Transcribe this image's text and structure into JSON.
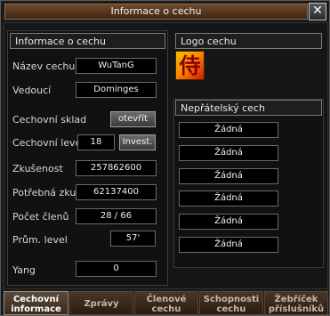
{
  "window": {
    "title": "Informace o cechu",
    "close_glyph": "✕"
  },
  "guild_info": {
    "header": "Informace o cechu",
    "name_label": "Název cechu",
    "name_value": "WuTanG",
    "leader_label": "Vedoucí",
    "leader_value": "Dominges",
    "storage_label": "Cechovní sklad",
    "storage_button": "otevřít",
    "level_label": "Cechovní level",
    "level_value": "18",
    "invest_button": "Invest.",
    "exp_label": "Zkušenost",
    "exp_value": "257862600",
    "needed_exp_label": "Potřebná zkuš.",
    "needed_exp_value": "62137400",
    "members_label": "Počet členů",
    "members_value": "28 / 66",
    "avg_level_label": "Prům. level",
    "avg_level_value": "57'",
    "yang_label": "Yang",
    "yang_value": "0"
  },
  "logo": {
    "header": "Logo cechu",
    "glyph": "侍"
  },
  "enemies": {
    "header": "Nepřátelský cech",
    "slots": [
      "Žádná",
      "Žádná",
      "Žádná",
      "Žádná",
      "Žádná",
      "Žádná"
    ]
  },
  "tabs": [
    {
      "line1": "Cechovní",
      "line2": "informace"
    },
    {
      "line1": "Zprávy",
      "line2": ""
    },
    {
      "line1": "Členové",
      "line2": "cechu"
    },
    {
      "line1": "Schopnosti",
      "line2": "cechu"
    },
    {
      "line1": "Žebříček",
      "line2": "příslušníků"
    }
  ]
}
